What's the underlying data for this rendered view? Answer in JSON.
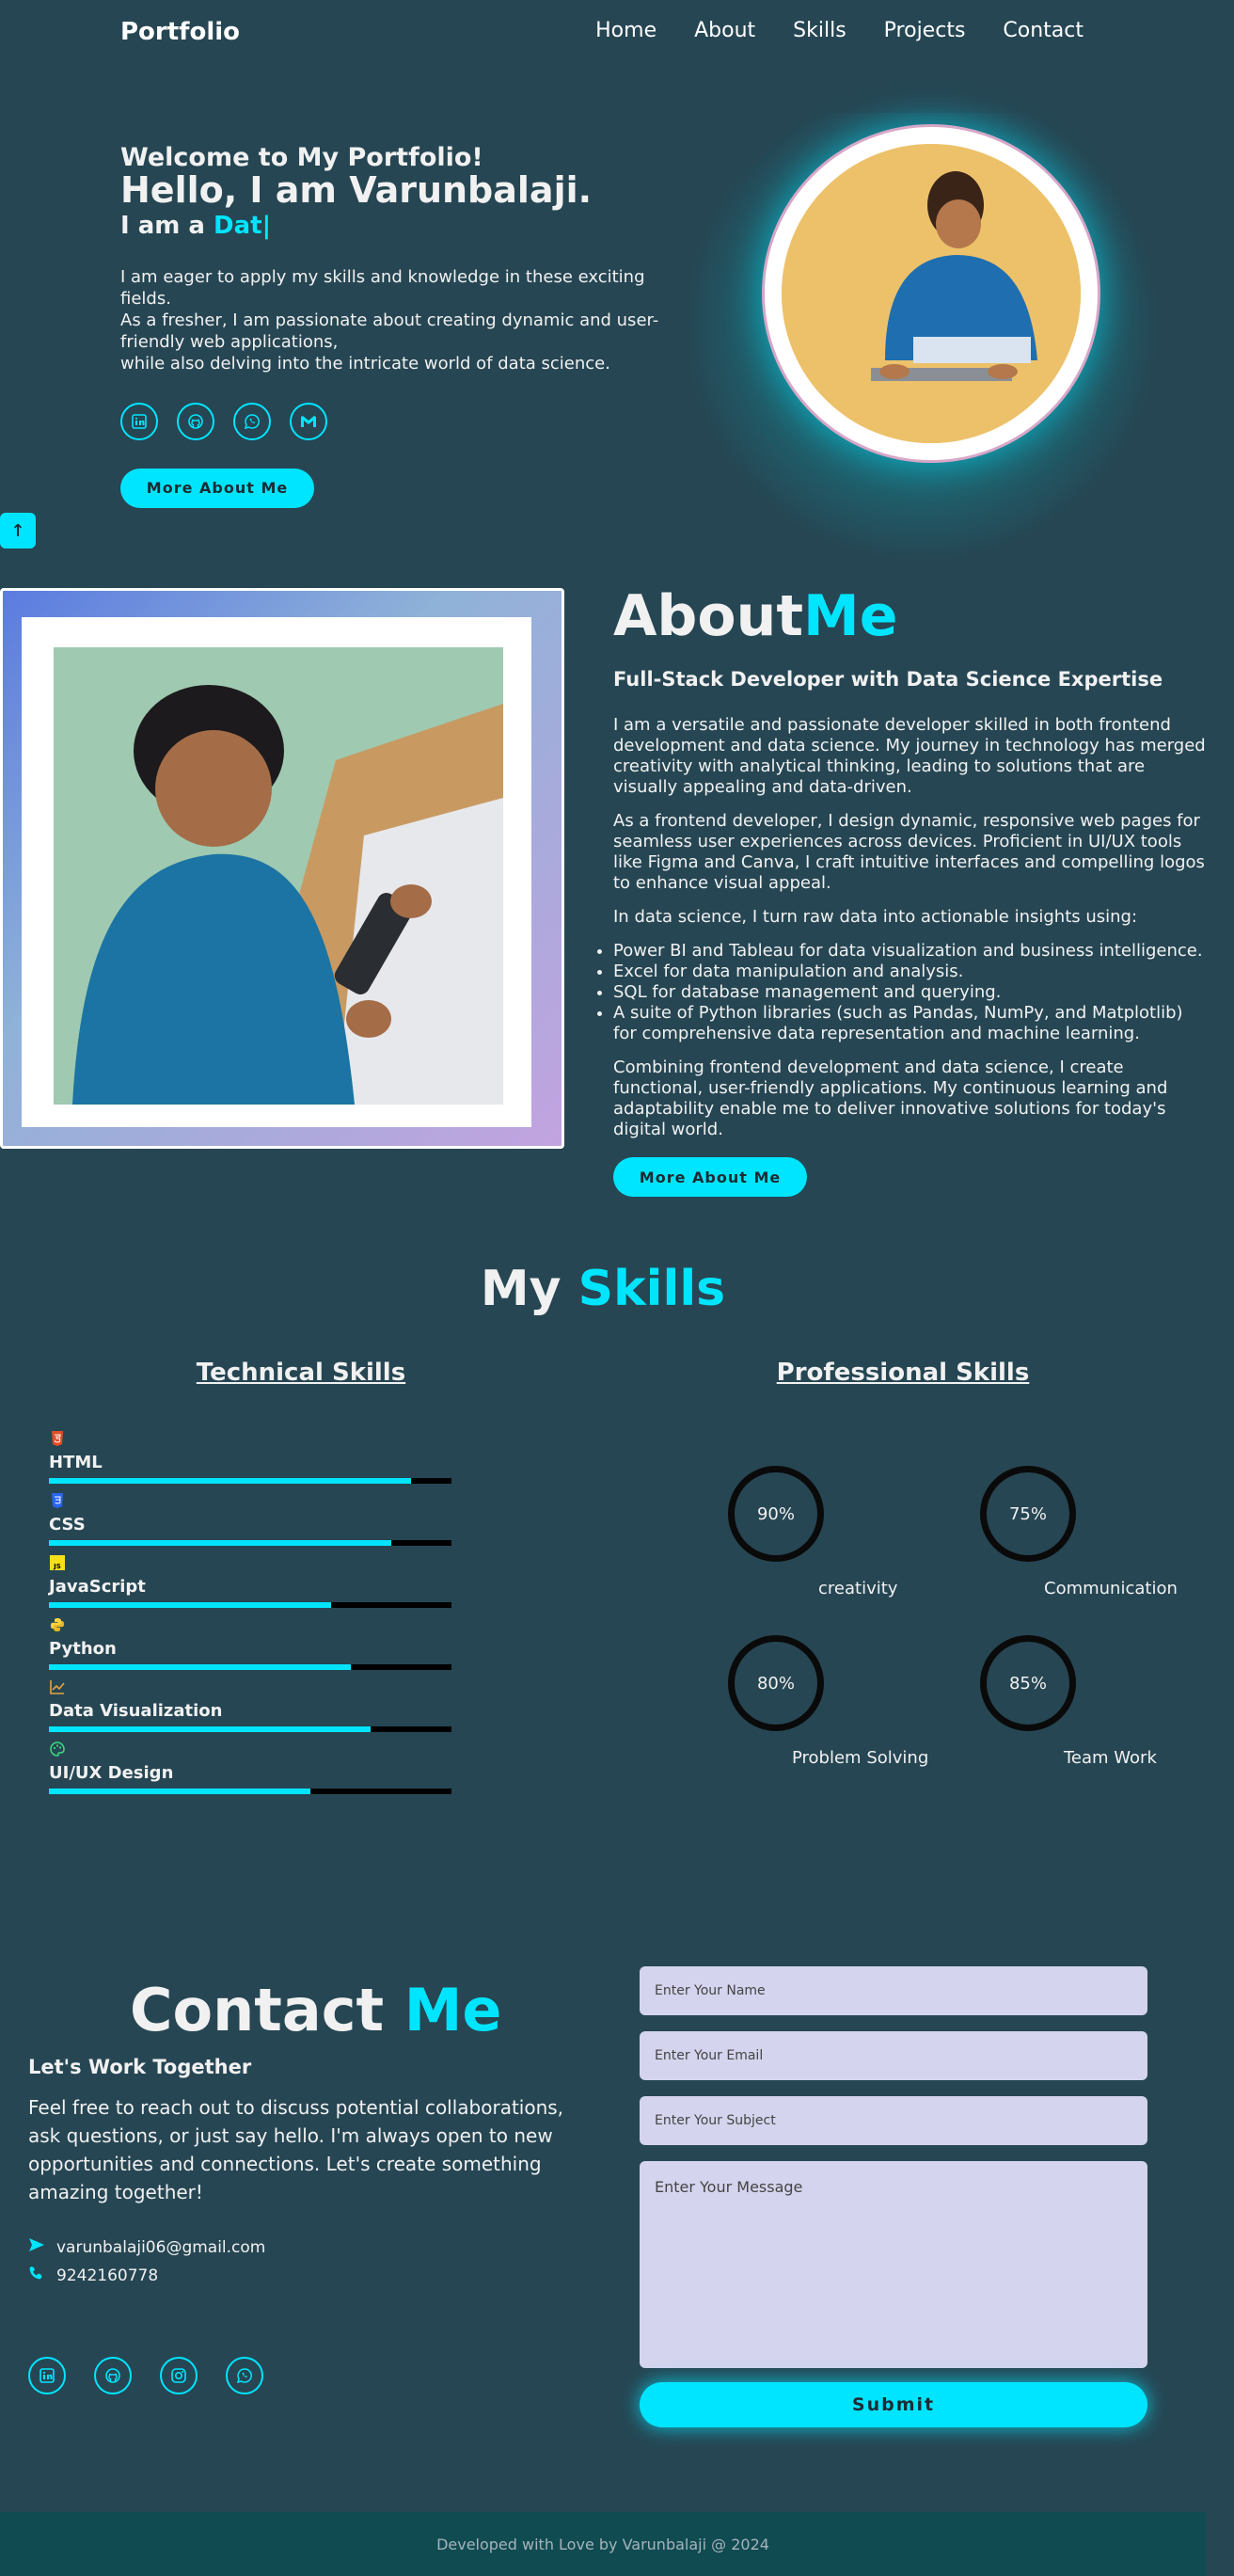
{
  "nav": {
    "brand": "Portfolio",
    "links": [
      "Home",
      "About",
      "Skills",
      "Projects",
      "Contact"
    ]
  },
  "hero": {
    "welcome": "Welcome to My Portfolio!",
    "hello": "Hello, I am Varunbalaji.",
    "iam_prefix": "I am a ",
    "typed": "Dat|",
    "desc": [
      "I am eager to apply my skills and knowledge in these exciting fields.",
      "As a fresher, I am passionate about creating dynamic and user-friendly web applications,",
      "while also delving into the intricate world of data science."
    ],
    "social_icons": [
      "linkedin-icon",
      "github-icon",
      "whatsapp-icon",
      "gmail-icon"
    ],
    "button": "More About Me"
  },
  "scroll_top_icon": "arrow-up-icon",
  "about": {
    "title_a": "About",
    "title_b": "Me",
    "subtitle": "Full-Stack Developer with Data Science Expertise",
    "p1": "I am a versatile and passionate developer skilled in both frontend development and data science. My journey in technology has merged creativity with analytical thinking, leading to solutions that are visually appealing and data-driven.",
    "p2": "As a frontend developer, I design dynamic, responsive web pages for seamless user experiences across devices. Proficient in UI/UX tools like Figma and Canva, I craft intuitive interfaces and compelling logos to enhance visual appeal.",
    "p3": "In data science, I turn raw data into actionable insights using:",
    "list": [
      "Power BI and Tableau for data visualization and business intelligence.",
      "Excel for data manipulation and analysis.",
      "SQL for database management and querying.",
      "A suite of Python libraries (such as Pandas, NumPy, and Matplotlib) for comprehensive data representation and machine learning."
    ],
    "p4": "Combining frontend development and data science, I create functional, user-friendly applications. My continuous learning and adaptability enable me to deliver innovative solutions for today's digital world.",
    "button": "More About Me"
  },
  "skills": {
    "title_a": "My ",
    "title_b": "Skills",
    "technical_heading": "Technical Skills",
    "professional_heading": "Professional Skills",
    "technical": [
      {
        "name": "HTML",
        "icon": "html5-icon",
        "level": 0.9,
        "color": "#e44d26"
      },
      {
        "name": "CSS",
        "icon": "css3-icon",
        "level": 0.85,
        "color": "#2965f1"
      },
      {
        "name": "JavaScript",
        "icon": "javascript-icon",
        "level": 0.7,
        "color": "#f7df1e"
      },
      {
        "name": "Python",
        "icon": "python-icon",
        "level": 0.75,
        "color": "#ffd43b"
      },
      {
        "name": "Data Visualization",
        "icon": "chart-icon",
        "level": 0.8,
        "color": "#e8a33d"
      },
      {
        "name": "UI/UX Design",
        "icon": "palette-icon",
        "level": 0.65,
        "color": "#3ddc84"
      }
    ],
    "professional": [
      {
        "name": "creativity",
        "value": "90%"
      },
      {
        "name": "Communication",
        "value": "75%"
      },
      {
        "name": "Problem Solving",
        "value": "80%"
      },
      {
        "name": "Team Work",
        "value": "85%"
      }
    ]
  },
  "contact": {
    "title_a": "Contact ",
    "title_b": "Me",
    "subtitle": "Let's Work Together",
    "text": "Feel free to reach out to discuss potential collaborations, ask questions, or just say hello. I'm always open to new opportunities and connections. Let's create something amazing together!",
    "email": "varunbalaji06@gmail.com",
    "phone": "9242160778",
    "social_icons": [
      "linkedin-icon",
      "github-icon",
      "instagram-icon",
      "whatsapp-icon"
    ],
    "form": {
      "name_placeholder": "Enter Your Name",
      "email_placeholder": "Enter Your Email",
      "subject_placeholder": "Enter Your Subject",
      "message_placeholder": "Enter Your Message",
      "submit": "Submit"
    }
  },
  "footer": "Developed with Love by Varunbalaji @ 2024",
  "colors": {
    "accent": "#00e5ff",
    "background": "#264653",
    "footer": "#114b52"
  }
}
